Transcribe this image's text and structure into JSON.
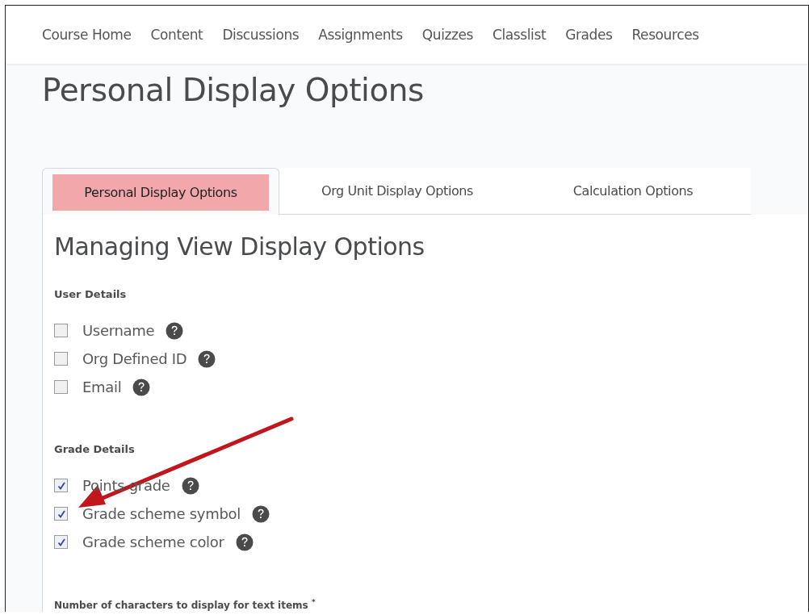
{
  "nav": {
    "items": [
      {
        "label": "Course Home"
      },
      {
        "label": "Content"
      },
      {
        "label": "Discussions"
      },
      {
        "label": "Assignments"
      },
      {
        "label": "Quizzes"
      },
      {
        "label": "Classlist"
      },
      {
        "label": "Grades"
      },
      {
        "label": "Resources"
      }
    ]
  },
  "page_title": "Personal Display Options",
  "tabs": [
    {
      "label": "Personal Display Options",
      "selected": true
    },
    {
      "label": "Org Unit Display Options",
      "selected": false
    },
    {
      "label": "Calculation Options",
      "selected": false
    }
  ],
  "heading": "Managing View Display Options",
  "sections": [
    {
      "title": "User Details",
      "options": [
        {
          "label": "Username",
          "checked": false
        },
        {
          "label": "Org Defined ID",
          "checked": false
        },
        {
          "label": "Email",
          "checked": false
        }
      ]
    },
    {
      "title": "Grade Details",
      "options": [
        {
          "label": "Points grade",
          "checked": true
        },
        {
          "label": "Grade scheme symbol",
          "checked": true
        },
        {
          "label": "Grade scheme color",
          "checked": true
        }
      ]
    }
  ],
  "field_label": "Number of characters to display for text items",
  "required_mark": "*"
}
